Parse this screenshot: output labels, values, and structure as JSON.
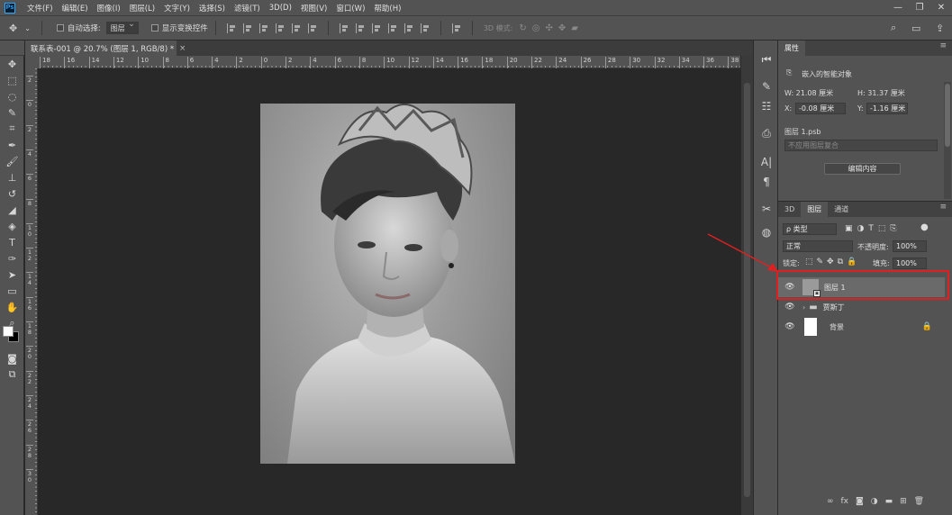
{
  "app": {
    "logo_text": "Ps"
  },
  "menu": [
    "文件(F)",
    "编辑(E)",
    "图像(I)",
    "图层(L)",
    "文字(Y)",
    "选择(S)",
    "滤镜(T)",
    "3D(D)",
    "视图(V)",
    "窗口(W)",
    "帮助(H)"
  ],
  "options": {
    "auto_select_label": "自动选择:",
    "auto_select_value": "图层",
    "show_transform_label": "显示变换控件",
    "mode_3d_label": "3D 模式:"
  },
  "document_tab": {
    "title": "联系表-001 @ 20.7% (图层 1, RGB/8) *",
    "close": "×"
  },
  "ruler": {
    "top": [
      "18",
      "16",
      "14",
      "12",
      "10",
      "8",
      "6",
      "4",
      "2",
      "0",
      "2",
      "4",
      "6",
      "8",
      "10",
      "12",
      "14",
      "16",
      "18",
      "20",
      "22",
      "24",
      "26",
      "28",
      "30",
      "32",
      "34",
      "36",
      "38"
    ],
    "left": [
      "2",
      "0",
      "2",
      "4",
      "6",
      "8",
      "1 0",
      "1 2",
      "1 4",
      "1 6",
      "1 8",
      "2 0",
      "2 2",
      "2 4",
      "2 6",
      "2 8",
      "3 0"
    ]
  },
  "properties": {
    "tab": "属性",
    "type_label": "嵌入的智能对象",
    "w": "W:  21.08 厘米",
    "h": "H:  31.37 厘米",
    "x_label": "X:",
    "x_value": "-0.08 厘米",
    "y_label": "Y:",
    "y_value": "-1.16 厘米",
    "file": "图层 1.psb",
    "comp_placeholder": "不应用图层复合",
    "edit_button": "编辑内容"
  },
  "layers_panel": {
    "tabs": [
      "3D",
      "图层",
      "通道"
    ],
    "active_tab": "图层",
    "filter_kind": "ρ 类型",
    "blend_mode": "正常",
    "opacity_label": "不透明度:",
    "opacity_value": "100%",
    "lock_label": "锁定:",
    "fill_label": "填充:",
    "fill_value": "100%",
    "layers": [
      {
        "name": "图层 1",
        "type": "smart-object",
        "selected": true
      },
      {
        "name": "贾斯丁",
        "type": "group",
        "selected": false
      },
      {
        "name": "背景",
        "type": "background",
        "selected": false,
        "locked": true
      }
    ]
  },
  "colors": {
    "highlight": "#e02020",
    "accent": "#31a8ff"
  }
}
